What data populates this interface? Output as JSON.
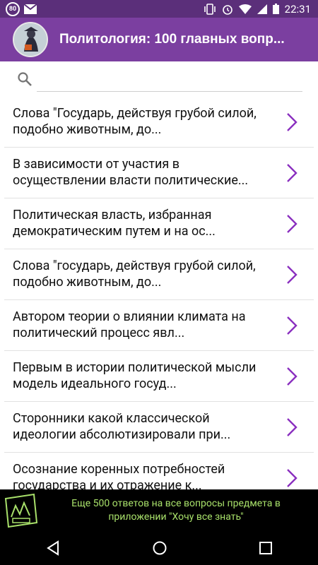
{
  "status_bar": {
    "badge": "80",
    "time": "22:31"
  },
  "app_bar": {
    "title": "Политология: 100 главных вопр..."
  },
  "search": {
    "placeholder": ""
  },
  "list": [
    {
      "text": "Слова \"Государь, действуя грубой силой, подобно животным, до..."
    },
    {
      "text": "В зависимости от участия в осуществлении власти политические..."
    },
    {
      "text": "Политическая власть, избранная демократическим путем и на ос..."
    },
    {
      "text": "Слова \"государь, действуя грубой силой, подобно животным, до..."
    },
    {
      "text": "Автором теории о влиянии климата на политический процесс явл..."
    },
    {
      "text": "Первым в истории политической мысли модель идеального  госуд..."
    },
    {
      "text": "Сторонники какой классической идеологии абсолютизировали при..."
    },
    {
      "text": "Осознание коренных потребностей государства и их отражение к..."
    }
  ],
  "banner": {
    "text": "Еще 500 ответов на все вопросы предмета в приложении \"Хочу все знать\""
  },
  "colors": {
    "statusbar": "#5b2f7a",
    "appbar": "#7b3fa0",
    "chevron": "#8a2fbf",
    "banner_text": "#a8e06a"
  }
}
